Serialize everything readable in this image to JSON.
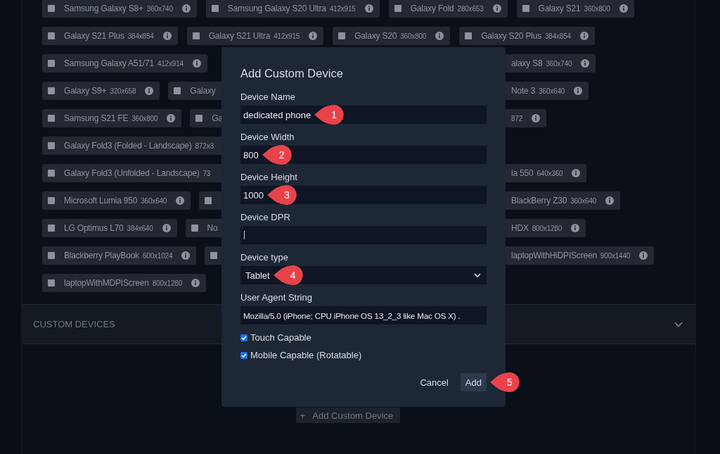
{
  "device_rows": [
    {
      "chips": [
        {
          "name": "Samsung Galaxy S8+",
          "size": "360x740",
          "checked": false,
          "info": true
        },
        {
          "name": "Samsung Galaxy S20 Ultra",
          "size": "412x915",
          "checked": false,
          "info": true
        },
        {
          "name": "Galaxy Fold",
          "size": "280x653",
          "checked": false,
          "info": true
        },
        {
          "name": "Galaxy S21",
          "size": "360x800",
          "checked": false,
          "info": true
        }
      ]
    },
    {
      "chips": [
        {
          "name": "Galaxy S21 Plus",
          "size": "384x854",
          "checked": false,
          "info": true
        },
        {
          "name": "Galaxy S21 Ultra",
          "size": "412x915",
          "checked": false,
          "info": true
        },
        {
          "name": "Galaxy S20",
          "size": "360x800",
          "checked": false,
          "info": true
        },
        {
          "name": "Galaxy S20 Plus",
          "size": "384x854",
          "checked": false,
          "info": true
        }
      ]
    },
    {
      "left": [
        {
          "name": "Samsung Galaxy A51/71",
          "size": "412x914",
          "checked": false,
          "info": true
        }
      ],
      "right": [
        {
          "name": "alaxy S8",
          "size": "360x740",
          "info": true
        }
      ]
    },
    {
      "left": [
        {
          "name": "Galaxy S9+",
          "size": "320x658",
          "checked": false,
          "info": true
        },
        {
          "name": "Galaxy",
          "checked": false,
          "info": false
        }
      ],
      "right": [
        {
          "name": "Note 3",
          "size": "360x640",
          "info": true
        }
      ]
    },
    {
      "left": [
        {
          "name": "Samsung S21 FE",
          "size": "360x800",
          "checked": false,
          "info": true
        },
        {
          "name": "Ga",
          "checked": false,
          "info": false
        }
      ],
      "right": [
        {
          "size": "872",
          "info": true
        }
      ]
    },
    {
      "left": [
        {
          "name": "Galaxy Fold3 (Folded - Landscape)",
          "size": "872x3",
          "checked": false,
          "info": false
        }
      ],
      "right": []
    },
    {
      "left": [
        {
          "name": "Galaxy Fold3 (Unfolded - Landscape)",
          "size": "73",
          "checked": false,
          "info": false
        }
      ],
      "right": [
        {
          "name": "ia 550",
          "size": "640x360",
          "info": true
        }
      ]
    },
    {
      "left": [
        {
          "name": "Microsoft Lumia 950",
          "size": "360x640",
          "checked": false,
          "info": true
        },
        {
          "checked": false,
          "info": false
        }
      ],
      "right": [
        {
          "name": "BlackBerry Z30",
          "size": "360x640",
          "info": true
        }
      ]
    },
    {
      "left": [
        {
          "name": "LG Optimus L70",
          "size": "384x640",
          "checked": false,
          "info": true
        },
        {
          "name": "No",
          "checked": false,
          "info": false
        }
      ],
      "right": [
        {
          "name": "HDX",
          "size": "800x1280",
          "info": true
        }
      ]
    },
    {
      "left": [
        {
          "name": "Blackberry PlayBook",
          "size": "600x1024",
          "checked": false,
          "info": true
        },
        {
          "checked": false,
          "info": false
        }
      ],
      "right": [
        {
          "name": "laptopWithHiDPIScreen",
          "size": "900x1440",
          "info": true
        }
      ]
    },
    {
      "left": [
        {
          "name": "laptopWithMDPIScreen",
          "size": "800x1280",
          "checked": false,
          "info": true
        }
      ],
      "right": []
    }
  ],
  "custom_devices": {
    "title": "CUSTOM DEVICES",
    "add_button": {
      "icon": "+",
      "label": "Add Custom Device"
    }
  },
  "dialog": {
    "title": "Add Custom Device",
    "fields": [
      {
        "kind": "text",
        "label": "Device Name",
        "value": "dedicated phone",
        "callout": "1"
      },
      {
        "kind": "text",
        "label": "Device Width",
        "value": "800",
        "callout": "2"
      },
      {
        "kind": "text",
        "label": "Device Height",
        "value": "1000",
        "callout": "3"
      },
      {
        "kind": "text",
        "label": "Device DPR",
        "focused": true
      },
      {
        "kind": "select",
        "label": "Device type",
        "value": "Tablet",
        "callout": "4"
      },
      {
        "kind": "text",
        "label": "User Agent String",
        "value": "Mozilla/5.0 (iPhone; CPU iPhone OS 13_2_3 like Mac OS X) ."
      }
    ],
    "checkboxes": [
      {
        "label": "Touch Capable",
        "checked": true
      },
      {
        "label": "Mobile Capable (Rotatable)",
        "checked": true
      }
    ],
    "buttons": [
      {
        "kind": "secondary",
        "label": "Cancel"
      },
      {
        "kind": "primary",
        "label": "Add",
        "callout": "5"
      }
    ]
  }
}
